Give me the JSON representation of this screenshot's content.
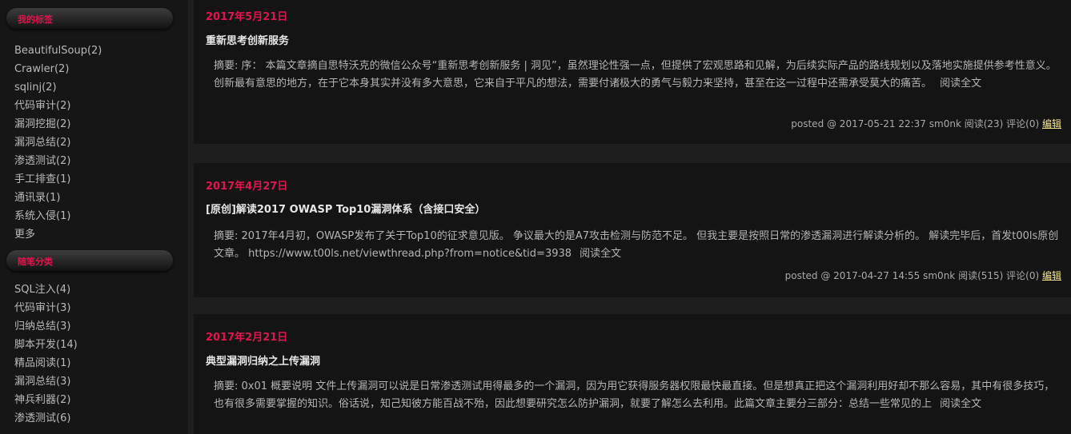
{
  "sidebar": {
    "tags_title": "我的标签",
    "tags": [
      "BeautifulSoup(2)",
      "Crawler(2)",
      "sqlinj(2)",
      "代码审计(2)",
      "漏洞挖掘(2)",
      "漏洞总结(2)",
      "渗透测试(2)",
      "手工排查(1)",
      "通讯录(1)",
      "系统入侵(1)",
      "更多"
    ],
    "categories_title": "随笔分类",
    "categories": [
      "SQL注入(4)",
      "代码审计(3)",
      "归纳总结(3)",
      "脚本开发(14)",
      "精品阅读(1)",
      "漏洞总结(3)",
      "神兵利器(2)",
      "渗透测试(6)"
    ]
  },
  "posts": [
    {
      "date": "2017年5月21日",
      "title": "重新思考创新服务",
      "summary_label": "摘要:",
      "summary": "序： 本篇文章摘自思特沃克的微信公众号“重新思考创新服务 | 洞见”，虽然理论性强一点，但提供了宏观思路和见解，为后续实际产品的路线规划以及落地实施提供参考性意义。 创新最有意思的地方，在于它本身其实并没有多大意思，它来自于平凡的想法，需要付诸极大的勇气与毅力来坚持，甚至在这一过程中还需承受莫大的痛苦。",
      "read_more": "阅读全文",
      "footer": "posted @ 2017-05-21 22:37 sm0nk 阅读(23) 评论(0)",
      "edit": "编辑"
    },
    {
      "date": "2017年4月27日",
      "title": "[原创]解读2017 OWASP Top10漏洞体系（含接口安全）",
      "summary_label": "摘要:",
      "summary": "2017年4月初，OWASP发布了关于Top10的征求意见版。 争议最大的是A7攻击检测与防范不足。 但我主要是按照日常的渗透漏洞进行解读分析的。 解读完毕后，首发t00ls原创文章。 https://www.t00ls.net/viewthread.php?from=notice&tid=3938",
      "read_more": "阅读全文",
      "footer": "posted @ 2017-04-27 14:55 sm0nk 阅读(515) 评论(0)",
      "edit": "编辑"
    },
    {
      "date": "2017年2月21日",
      "title": "典型漏洞归纳之上传漏洞",
      "summary_label": "摘要:",
      "summary": "0x01 概要说明 文件上传漏洞可以说是日常渗透测试用得最多的一个漏洞，因为用它获得服务器权限最快最直接。但是想真正把这个漏洞利用好却不那么容易，其中有很多技巧，也有很多需要掌握的知识。俗话说，知己知彼方能百战不殆，因此想要研究怎么防护漏洞，就要了解怎么去利用。此篇文章主要分三部分：总结一些常见的上",
      "read_more": "阅读全文"
    }
  ]
}
